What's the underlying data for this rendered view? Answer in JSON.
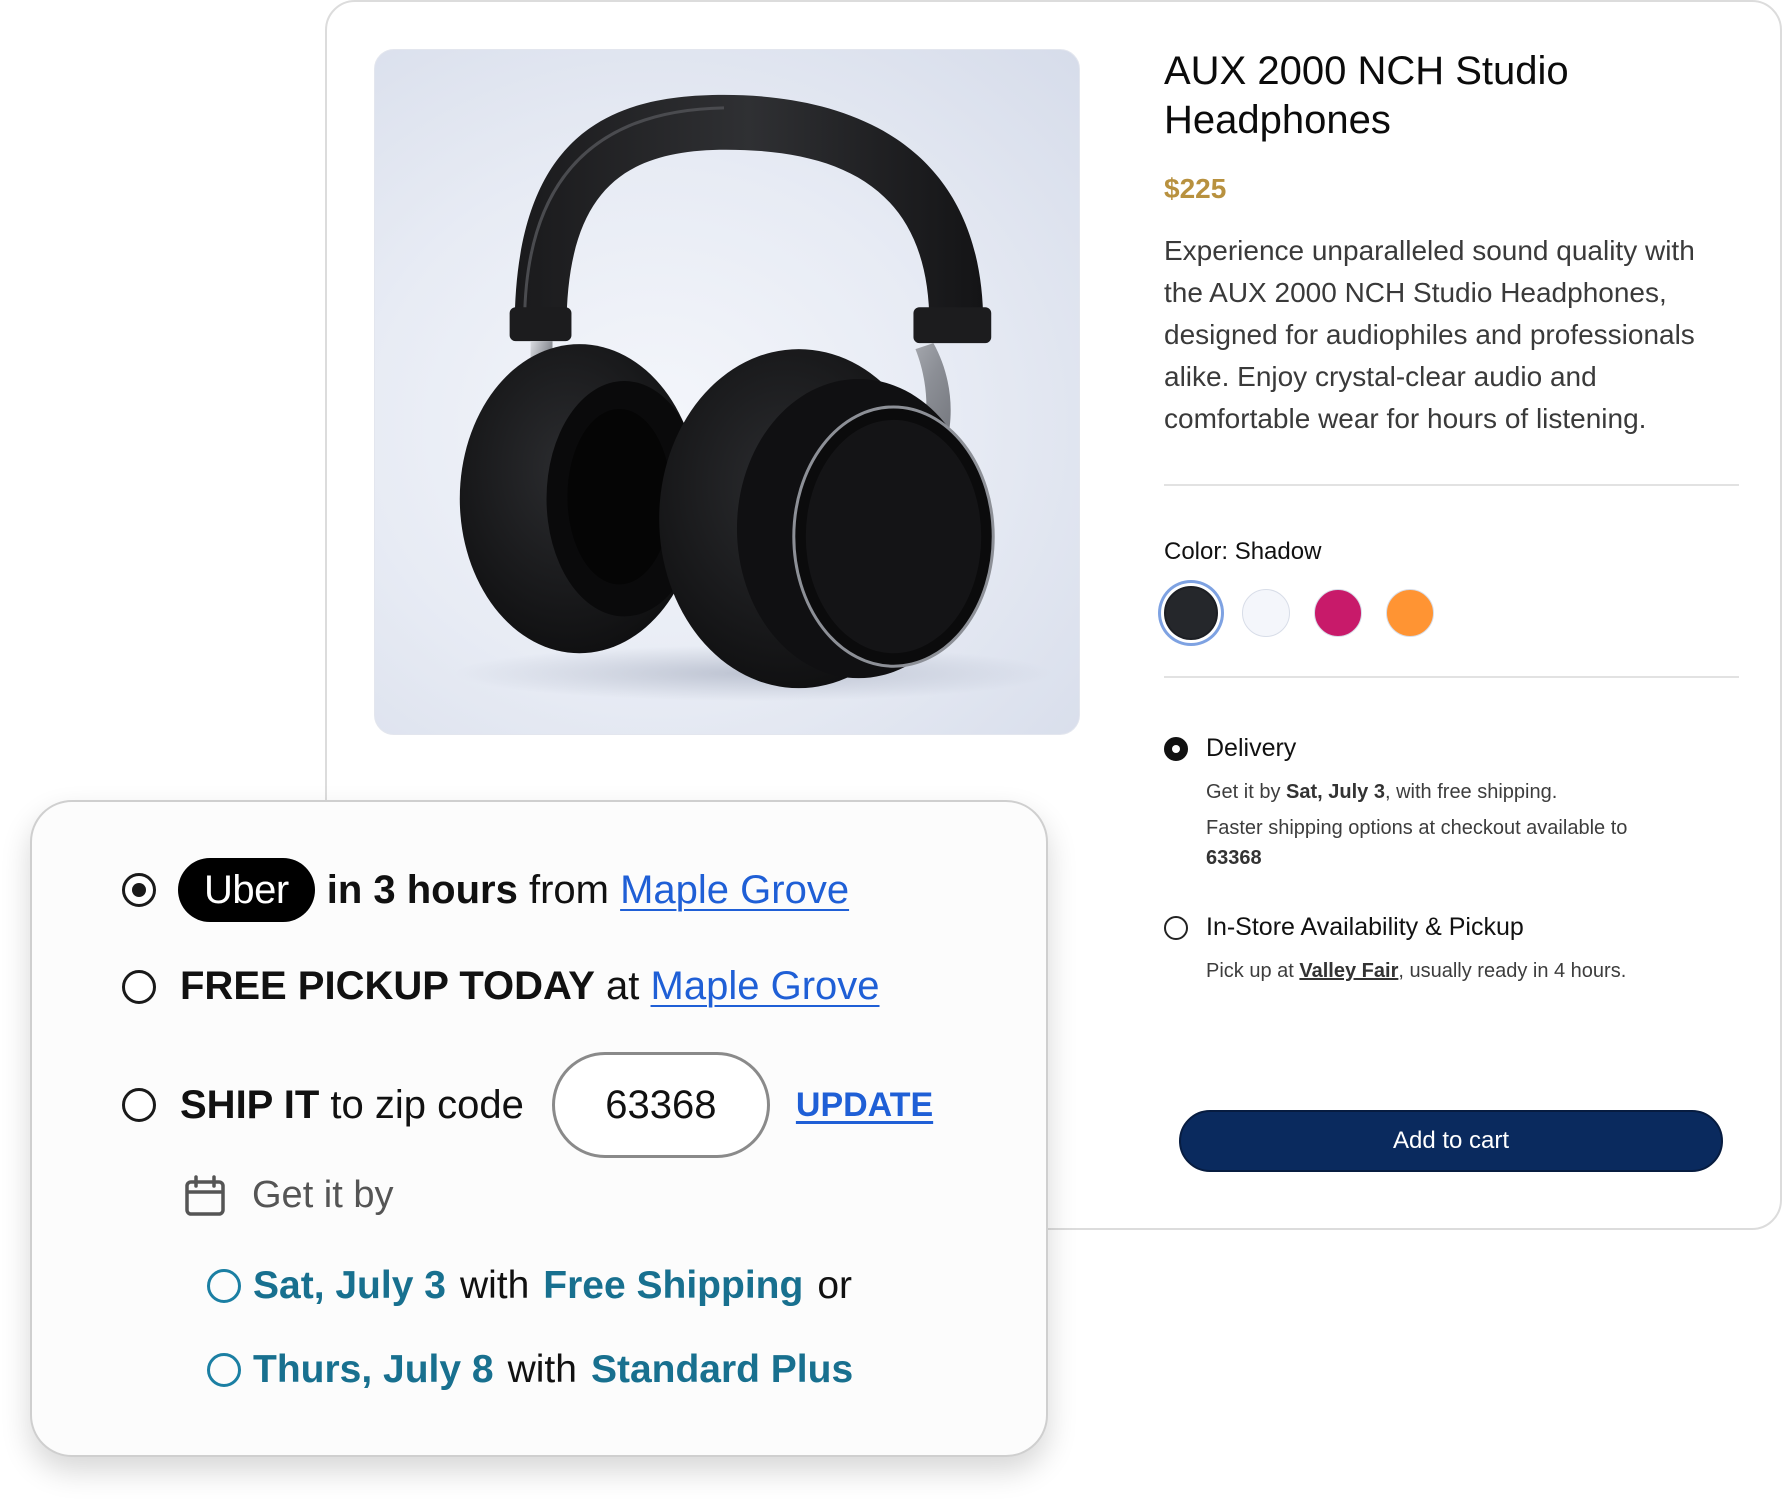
{
  "product": {
    "title": "AUX 2000 NCH Studio Headphones",
    "price": "$225",
    "description": "Experience unparalleled sound quality with the AUX 2000 NCH Studio Headphones, designed for audiophiles and professionals alike. Enjoy crystal-clear audio and comfortable wear for hours of listening.",
    "color_label": "Color:",
    "color_value": "Shadow",
    "swatches": [
      {
        "name": "Shadow",
        "hex": "#25272b",
        "selected": true
      },
      {
        "name": "White",
        "hex": "#f4f6fb",
        "selected": false
      },
      {
        "name": "Magenta",
        "hex": "#c81a6a",
        "selected": false
      },
      {
        "name": "Orange",
        "hex": "#ff9433",
        "selected": false
      }
    ],
    "add_to_cart": "Add to cart"
  },
  "fulfillment": {
    "delivery": {
      "title": "Delivery",
      "get_it_prefix": "Get it by",
      "get_it_date": "Sat, July 3",
      "get_it_suffix": ", with free shipping.",
      "faster": "Faster shipping options at checkout available to",
      "zip": "63368",
      "selected": true
    },
    "pickup": {
      "title": "In-Store Availability & Pickup",
      "prefix": "Pick up at",
      "store": "Valley Fair",
      "suffix": ", usually ready in 4 hours.",
      "selected": false
    }
  },
  "shipping_card": {
    "uber": {
      "brand": "Uber",
      "time": "in 3 hours",
      "from": "from",
      "store": "Maple Grove"
    },
    "pickup": {
      "label": "FREE PICKUP TODAY",
      "at": "at",
      "store": "Maple Grove"
    },
    "ship": {
      "label": "SHIP IT",
      "to": "to zip code",
      "zip": "63368",
      "update": "UPDATE"
    },
    "get_it_by": "Get it by",
    "options": [
      {
        "date": "Sat, July 3",
        "with": "with",
        "method": "Free Shipping",
        "tail": "or"
      },
      {
        "date": "Thurs, July 8",
        "with": "with",
        "method": "Standard Plus",
        "tail": ""
      }
    ]
  }
}
